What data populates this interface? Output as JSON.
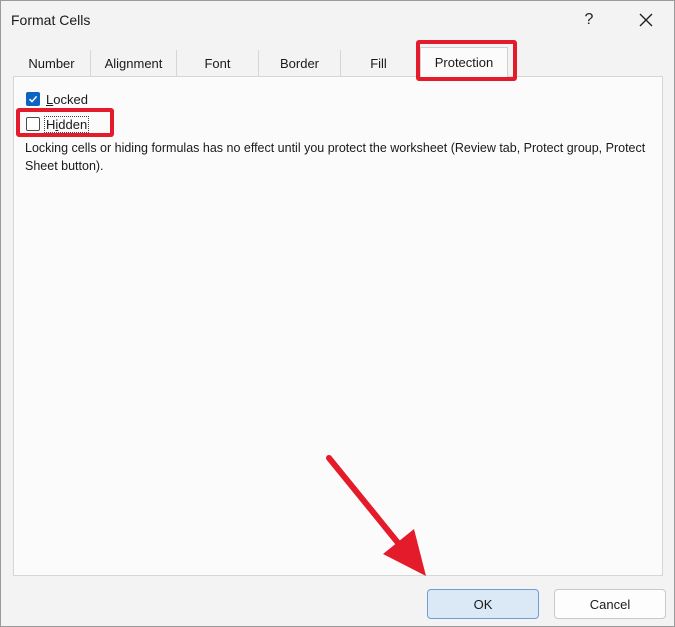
{
  "window": {
    "title": "Format Cells",
    "help_glyph": "?",
    "close_icon": "close-icon"
  },
  "tabs": [
    {
      "label": "Number"
    },
    {
      "label": "Alignment"
    },
    {
      "label": "Font"
    },
    {
      "label": "Border"
    },
    {
      "label": "Fill"
    },
    {
      "label": "Protection",
      "selected": true
    }
  ],
  "protection": {
    "locked": {
      "label_prefix": "",
      "label_mnemonic": "L",
      "label_rest": "ocked",
      "checked": true
    },
    "hidden": {
      "label_prefix": "H",
      "label_mnemonic": "i",
      "label_rest": "dden",
      "checked": false
    },
    "info_text": "Locking cells or hiding formulas has no effect until you protect the worksheet (Review tab, Protect group, Protect Sheet button)."
  },
  "buttons": {
    "ok": "OK",
    "cancel": "Cancel"
  },
  "colors": {
    "accent": "#0a64c2",
    "annotation": "#e31b2b",
    "ok_fill": "#dbe8f6"
  }
}
